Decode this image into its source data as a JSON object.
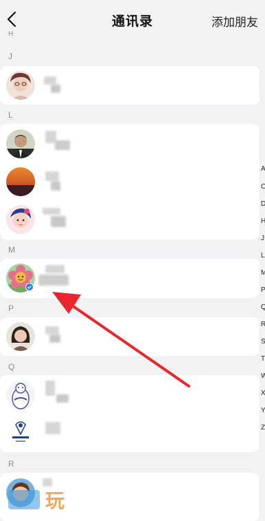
{
  "header": {
    "title": "通讯录",
    "add_friend": "添加朋友"
  },
  "sections": {
    "h": "H",
    "j": "J",
    "l": "L",
    "m": "M",
    "p": "P",
    "q": "Q",
    "r": "R"
  },
  "index_letters": [
    "A",
    "C",
    "D",
    "H",
    "J",
    "L",
    "M",
    "P",
    "Q",
    "R",
    "S",
    "T",
    "W",
    "X",
    "Y",
    "Z"
  ],
  "watermark": "玩",
  "colors": {
    "background": "#f2f2f4",
    "arrow": "#e8262b",
    "verified_badge": "#2f7de1"
  }
}
